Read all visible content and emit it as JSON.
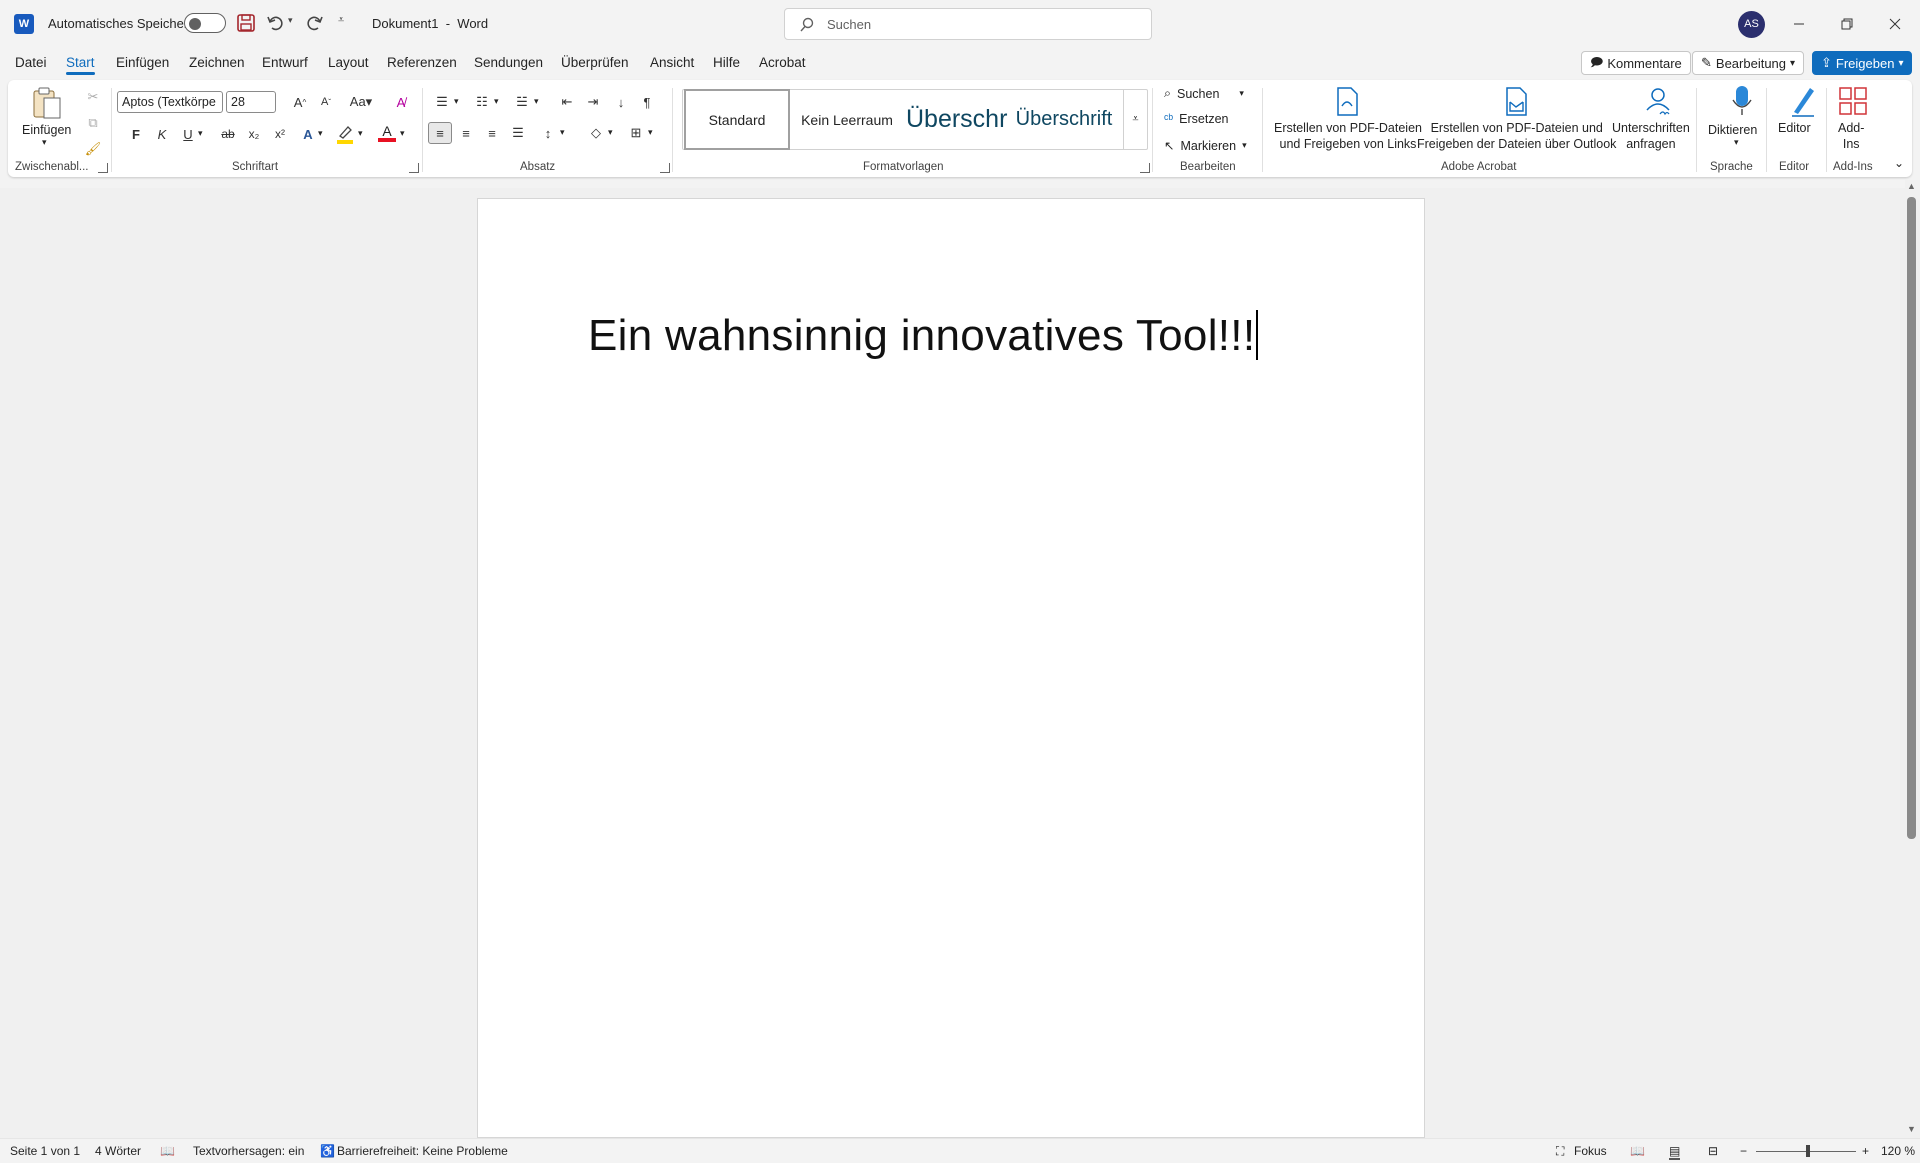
{
  "titlebar": {
    "app_logo": "W",
    "autosave_label": "Automatisches Speichern",
    "doc_title": "Dokument1",
    "app_sep": "-",
    "app_name": "Word",
    "search_placeholder": "Suchen",
    "avatar_initials": "AS"
  },
  "tabs": [
    "Datei",
    "Start",
    "Einfügen",
    "Zeichnen",
    "Entwurf",
    "Layout",
    "Referenzen",
    "Sendungen",
    "Überprüfen",
    "Ansicht",
    "Hilfe",
    "Acrobat"
  ],
  "header_buttons": {
    "comments": "Kommentare",
    "editing": "Bearbeitung",
    "share": "Freigeben"
  },
  "ribbon": {
    "clipboard": {
      "paste": "Einfügen",
      "group": "Zwischenabl..."
    },
    "font": {
      "family": "Aptos (Textkörpe",
      "size": "28",
      "bold": "F",
      "italic": "K",
      "underline": "U",
      "strike": "ab",
      "sub": "x₂",
      "sup": "x²",
      "group": "Schriftart"
    },
    "paragraph": {
      "group": "Absatz"
    },
    "styles": {
      "items": [
        "Standard",
        "Kein Leerraum",
        "Überschr",
        "Überschrift"
      ],
      "group": "Formatvorlagen"
    },
    "editing": {
      "find": "Suchen",
      "replace": "Ersetzen",
      "select": "Markieren",
      "group": "Bearbeiten"
    },
    "acrobat": {
      "pdf_links_1": "Erstellen von PDF-Dateien",
      "pdf_links_2": "und Freigeben von Links",
      "pdf_outlook_1": "Erstellen von PDF-Dateien und",
      "pdf_outlook_2": "Freigeben der Dateien über Outlook",
      "sign_1": "Unterschriften",
      "sign_2": "anfragen",
      "group": "Adobe Acrobat"
    },
    "voice": {
      "dictate": "Diktieren",
      "group": "Sprache"
    },
    "editor": {
      "label": "Editor",
      "group": "Editor"
    },
    "addins": {
      "label_1": "Add-",
      "label_2": "Ins",
      "group": "Add-Ins"
    }
  },
  "document": {
    "text": "Ein wahnsinnig innovatives Tool!!!"
  },
  "statusbar": {
    "page": "Seite 1 von 1",
    "words": "4 Wörter",
    "predictions": "Textvorhersagen: ein",
    "accessibility": "Barrierefreiheit: Keine Probleme",
    "focus": "Fokus",
    "zoom": "120 %"
  },
  "colors": {
    "accent": "#0f6cbd",
    "word_blue": "#185abd",
    "highlight": "#ffd700",
    "font_red": "#e81123"
  }
}
